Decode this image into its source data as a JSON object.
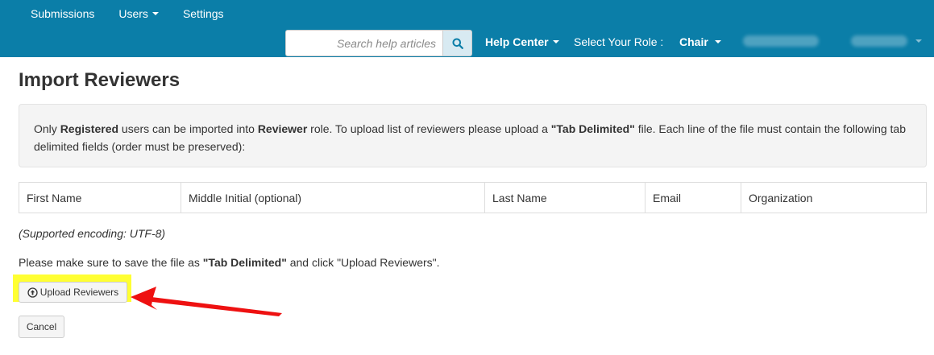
{
  "nav": {
    "items": [
      {
        "label": "Submissions"
      },
      {
        "label": "Users"
      },
      {
        "label": "Settings"
      }
    ],
    "search": {
      "placeholder": "Search help articles"
    },
    "help_center": "Help Center",
    "role_label": "Select Your Role :",
    "role_value": "Chair"
  },
  "page": {
    "title": "Import Reviewers",
    "info": {
      "t1": "Only ",
      "b1": "Registered",
      "t2": " users can be imported into ",
      "b2": "Reviewer",
      "t3": " role. To upload list of reviewers please upload a ",
      "b3": "\"Tab Delimited\"",
      "t4": " file. Each line of the file must contain the following tab delimited fields (order must be preserved):"
    },
    "fields": [
      "First Name",
      "Middle Initial (optional)",
      "Last Name",
      "Email",
      "Organization"
    ],
    "encoding_note": "(Supported encoding: UTF-8)",
    "save_note": {
      "t1": "Please make sure to save the file as ",
      "b1": "\"Tab Delimited\"",
      "t2": " and click \"Upload Reviewers\"."
    },
    "upload_button": "Upload Reviewers",
    "cancel_button": "Cancel"
  },
  "colors": {
    "navbar": "#0b7ea8",
    "highlight": "#ffff33",
    "arrow": "#ee1111"
  }
}
